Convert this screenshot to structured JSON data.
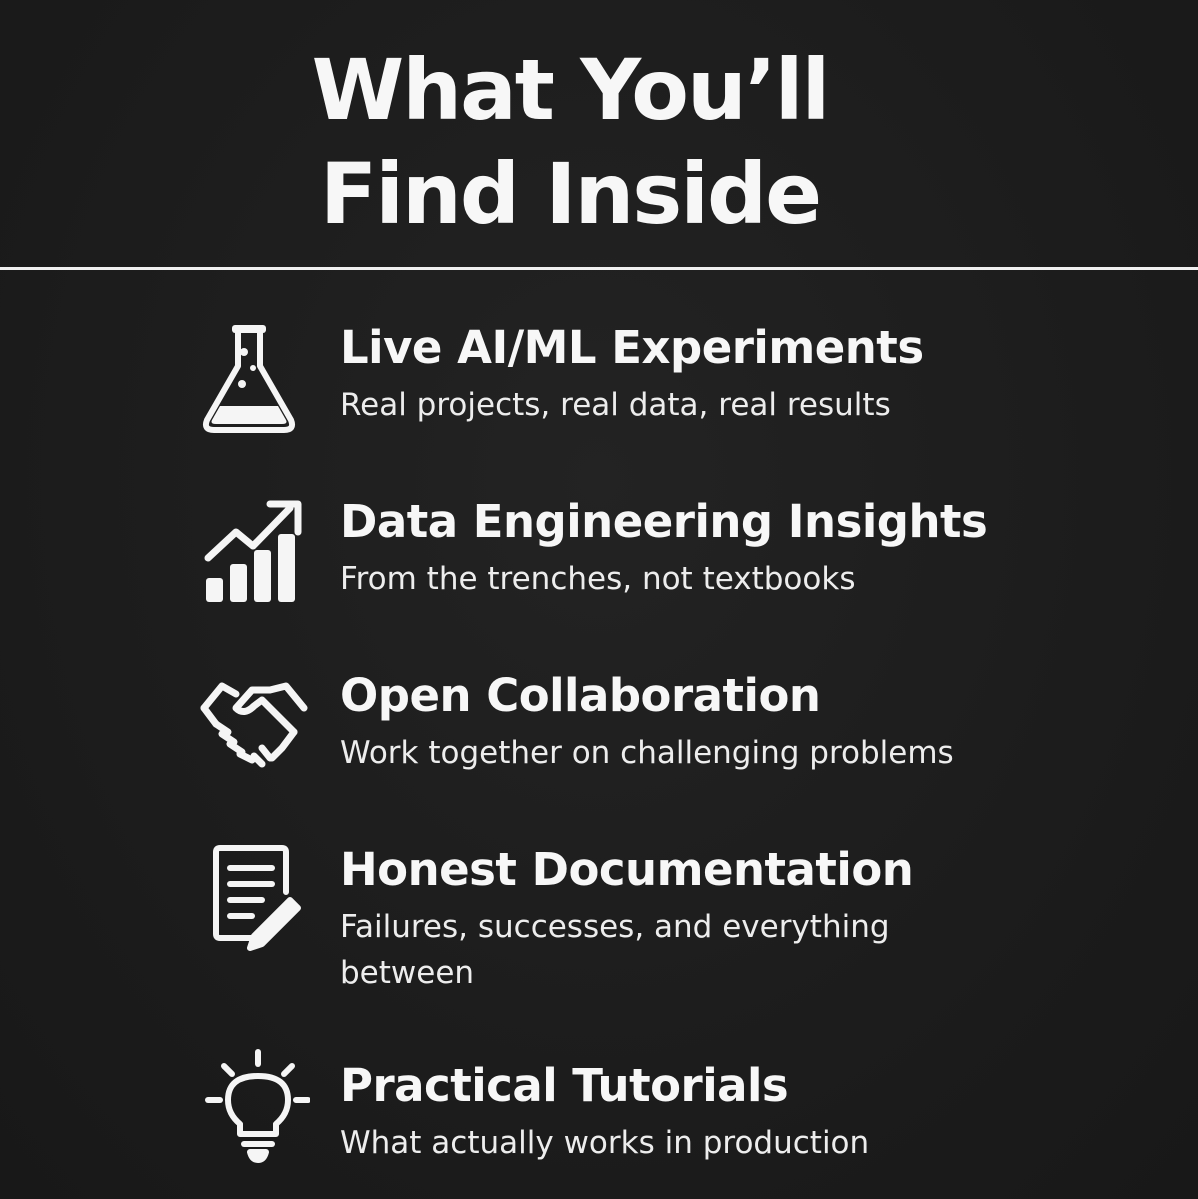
{
  "title": "What You’ll Find Inside",
  "features": [
    {
      "icon": "flask-icon",
      "heading": "Live AI/ML Experiments",
      "description": "Real projects, real data, real results"
    },
    {
      "icon": "growth-chart-icon",
      "heading": "Data Engineering Insights",
      "description": "From the trenches, not textbooks"
    },
    {
      "icon": "handshake-icon",
      "heading": "Open Collaboration",
      "description": "Work together on challenging problems"
    },
    {
      "icon": "document-pen-icon",
      "heading": "Honest Documentation",
      "description": "Failures, successes, and everything between"
    },
    {
      "icon": "lightbulb-icon",
      "heading": "Practical Tutorials",
      "description": "What actually works in production"
    }
  ]
}
